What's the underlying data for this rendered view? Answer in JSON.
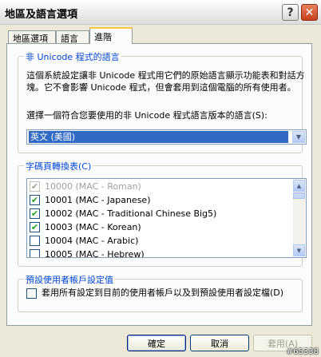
{
  "window": {
    "title": "地區及語言選項",
    "help_glyph": "?",
    "close_glyph": "✕"
  },
  "tabs": [
    {
      "label": "地區選項",
      "active": false
    },
    {
      "label": "語言",
      "active": false
    },
    {
      "label": "進階",
      "active": true
    }
  ],
  "non_unicode": {
    "legend": "非 Unicode 程式的語言",
    "description": "這個系統設定讓非 Unicode 程式用它們的原始語言顯示功能表和對話方塊。它不會影響 Unicode 程式，但會套用到這個電腦的所有使用者。",
    "prompt": "選擇一個符合您要使用的非 Unicode 程式語言版本的語言(S):",
    "selected_language": "英文 (美國)"
  },
  "code_pages": {
    "legend": "字碼頁轉換表(C)",
    "items": [
      {
        "label": "10000 (MAC - Roman)",
        "checked": true,
        "disabled": true
      },
      {
        "label": "10001 (MAC - Japanese)",
        "checked": true,
        "disabled": false
      },
      {
        "label": "10002 (MAC - Traditional Chinese Big5)",
        "checked": true,
        "disabled": false
      },
      {
        "label": "10003 (MAC - Korean)",
        "checked": true,
        "disabled": false
      },
      {
        "label": "10004 (MAC - Arabic)",
        "checked": false,
        "disabled": false
      },
      {
        "label": "10005 (MAC - Hebrew)",
        "checked": false,
        "disabled": false
      }
    ]
  },
  "default_user": {
    "legend": "預設使用者帳戶設定值",
    "checkbox_label": "套用所有設定到目前的使用者帳戶以及到預設使用者設定檔(D)",
    "checked": false
  },
  "buttons": {
    "ok": "確定",
    "cancel": "取消",
    "apply": "套用(A)"
  },
  "icons": {
    "check": "check-icon",
    "scroll_up": "arrow-up-icon",
    "scroll_down": "arrow-down-icon",
    "combo": "chevron-down-icon"
  },
  "watermark": "#65338"
}
